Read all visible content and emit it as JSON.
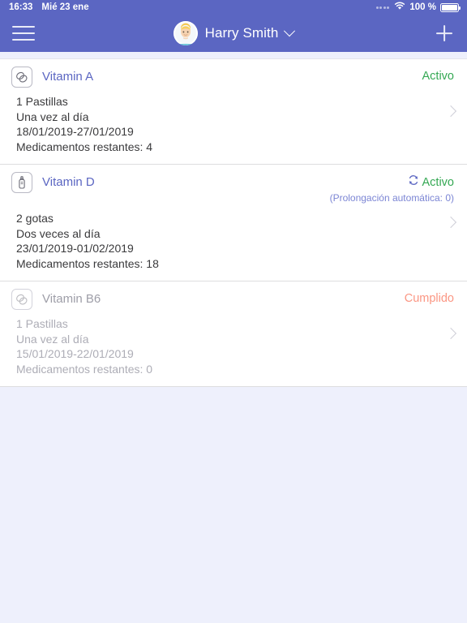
{
  "status_bar": {
    "time": "16:33",
    "date": "Mié 23 ene",
    "battery_percent": "100 %",
    "wifi_icon": "wifi-icon",
    "battery_icon": "battery-icon"
  },
  "nav": {
    "menu_icon": "hamburger-menu-icon",
    "user_name": "Harry Smith",
    "chevron_icon": "chevron-down-icon",
    "add_icon": "plus-icon",
    "avatar_icon": "user-avatar"
  },
  "colors": {
    "header": "#5b66c2",
    "page_bg": "#eef0fc",
    "card_bg": "#ffffff",
    "accent": "#5b66c2",
    "status_active": "#34a853",
    "status_done": "#fb9683",
    "status_sub": "#7b85d4"
  },
  "medications": [
    {
      "icon": "pills-icon",
      "name": "Vitamin A",
      "status": "Activo",
      "status_type": "active",
      "auto_renew": false,
      "auto_renew_note": "",
      "dose": "1 Pastillas",
      "frequency": "Una vez al día",
      "period": "18/01/2019-27/01/2019",
      "remaining": "Medicamentos restantes: 4",
      "completed": false
    },
    {
      "icon": "dropper-bottle-icon",
      "name": "Vitamin D",
      "status": "Activo",
      "status_type": "active",
      "auto_renew": true,
      "auto_renew_note": "(Prolongación automática: 0)",
      "dose": "2 gotas",
      "frequency": "Dos veces al día",
      "period": "23/01/2019-01/02/2019",
      "remaining": "Medicamentos restantes: 18",
      "completed": false
    },
    {
      "icon": "pills-icon",
      "name": "Vitamin B6",
      "status": "Cumplido",
      "status_type": "done",
      "auto_renew": false,
      "auto_renew_note": "",
      "dose": "1 Pastillas",
      "frequency": "Una vez al día",
      "period": "15/01/2019-22/01/2019",
      "remaining": "Medicamentos restantes: 0",
      "completed": true
    }
  ]
}
